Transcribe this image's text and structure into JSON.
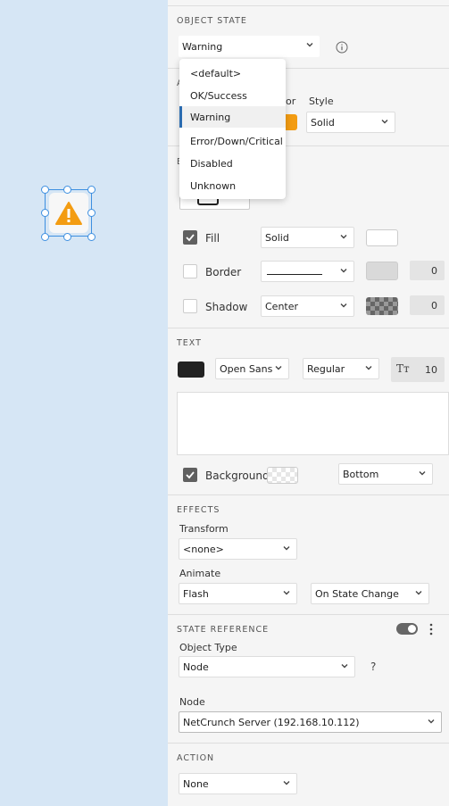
{
  "object_state": {
    "title": "OBJECT STATE",
    "selected": "Warning",
    "options": [
      "<default>",
      "OK/Success",
      "Warning",
      "Error/Down/Critical",
      "Disabled",
      "Unknown"
    ]
  },
  "appearance": {
    "title_partial": "A",
    "color_label_partial": "or",
    "color": "#f39c12",
    "style_label": "Style",
    "style_value": "Solid"
  },
  "border_section_title_partial": "B",
  "fill": {
    "label": "Fill",
    "checked": true,
    "value": "Solid",
    "color": "#ffffff"
  },
  "border": {
    "label": "Border",
    "checked": false,
    "number": "0"
  },
  "shadow": {
    "label": "Shadow",
    "checked": false,
    "value": "Center",
    "number": "0"
  },
  "text": {
    "title": "TEXT",
    "color": "#222222",
    "font": "Open Sans",
    "weight": "Regular",
    "size": "10",
    "size_icon": "Tт",
    "background_label": "Background",
    "background_checked": true,
    "position": "Bottom"
  },
  "effects": {
    "title": "EFFECTS",
    "transform_label": "Transform",
    "transform_value": "<none>",
    "animate_label": "Animate",
    "animate_value": "Flash",
    "animate_trigger": "On State Change"
  },
  "state_reference": {
    "title": "STATE REFERENCE",
    "object_type_label": "Object Type",
    "object_type_value": "Node",
    "help": "?",
    "node_label": "Node",
    "node_value": "NetCrunch Server (192.168.10.112)"
  },
  "action": {
    "title": "ACTION",
    "value": "None"
  },
  "colors": {
    "accent": "#2b6cb0",
    "selection": "#3d8fe0",
    "warning": "#f39c12",
    "canvas": "#d6e6f5"
  }
}
